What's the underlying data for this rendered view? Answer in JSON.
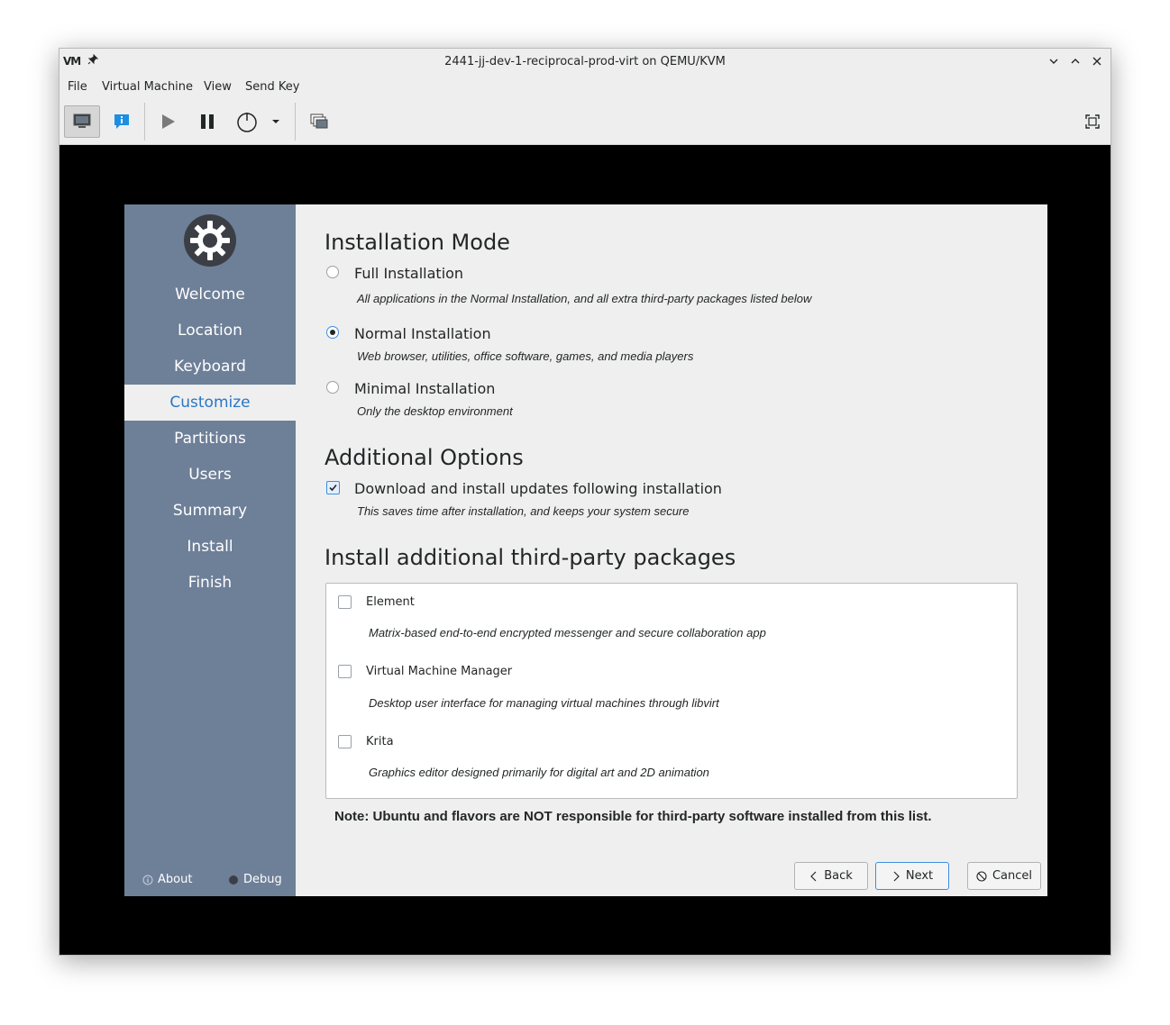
{
  "window": {
    "title": "2441-jj-dev-1-reciprocal-prod-virt on QEMU/KVM",
    "app_logo": "VM"
  },
  "menubar": {
    "file": "File",
    "virtual_machine": "Virtual Machine",
    "view": "View",
    "send_key": "Send Key"
  },
  "sidebar": {
    "items": [
      "Welcome",
      "Location",
      "Keyboard",
      "Customize",
      "Partitions",
      "Users",
      "Summary",
      "Install",
      "Finish"
    ],
    "active_index": 3,
    "about": "About",
    "debug": "Debug"
  },
  "installation_mode": {
    "heading": "Installation Mode",
    "options": [
      {
        "label": "Full Installation",
        "description": "All applications in the Normal Installation, and all extra third-party packages listed below",
        "selected": false
      },
      {
        "label": "Normal Installation",
        "description": "Web browser, utilities, office software, games, and media players",
        "selected": true
      },
      {
        "label": "Minimal Installation",
        "description": "Only the desktop environment",
        "selected": false
      }
    ]
  },
  "additional_options": {
    "heading": "Additional Options",
    "updates_label": "Download and install updates following installation",
    "updates_description": "This saves time after installation, and keeps your system secure",
    "updates_checked": true
  },
  "third_party": {
    "heading": "Install additional third-party packages",
    "packages": [
      {
        "name": "Element",
        "description": "Matrix-based end-to-end encrypted messenger and secure collaboration app",
        "checked": false
      },
      {
        "name": "Virtual Machine Manager",
        "description": "Desktop user interface for managing virtual machines through libvirt",
        "checked": false
      },
      {
        "name": "Krita",
        "description": "Graphics editor designed primarily for digital art and 2D animation",
        "checked": false
      }
    ],
    "note": "Note: Ubuntu and flavors are NOT responsible for third-party software installed from this list."
  },
  "buttons": {
    "back": "Back",
    "next": "Next",
    "cancel": "Cancel"
  },
  "colors": {
    "sidebar_bg": "#6e7f98",
    "accent": "#2a76c6",
    "content_bg": "#efefef"
  }
}
